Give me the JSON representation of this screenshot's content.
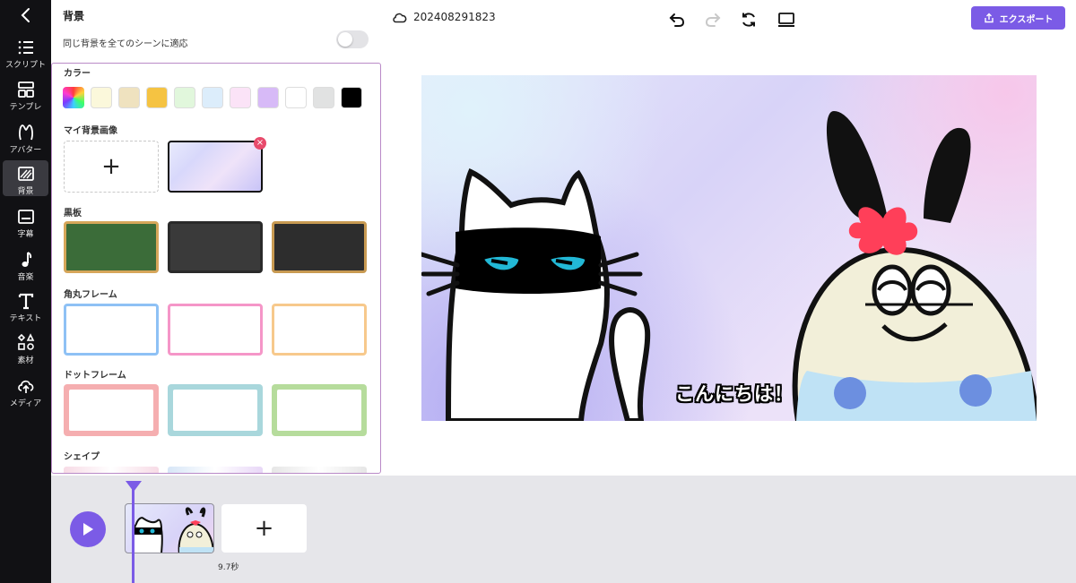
{
  "nav": {
    "items": [
      {
        "label": "スクリプト",
        "icon": "list-icon"
      },
      {
        "label": "テンプレ",
        "icon": "template-icon"
      },
      {
        "label": "アバター",
        "icon": "avatar-icon"
      },
      {
        "label": "背景",
        "icon": "background-icon"
      },
      {
        "label": "字幕",
        "icon": "subtitle-icon"
      },
      {
        "label": "音楽",
        "icon": "music-icon"
      },
      {
        "label": "テキスト",
        "icon": "text-icon"
      },
      {
        "label": "素材",
        "icon": "shapes-icon"
      },
      {
        "label": "メディア",
        "icon": "upload-icon"
      }
    ],
    "active": "背景"
  },
  "panel": {
    "title": "背景",
    "apply_all_label": "同じ背景を全てのシーンに適応",
    "apply_all_on": false,
    "sections": {
      "color": "カラー",
      "my_images": "マイ背景画像",
      "blackboard": "黒板",
      "rounded_frame": "角丸フレーム",
      "dot_frame": "ドットフレーム",
      "shape": "シェイプ"
    },
    "colors": [
      "#fbf8db",
      "#efe2bf",
      "#f5c342",
      "#e1f7dc",
      "#dcedfb",
      "#fbe3f7",
      "#d7baf7",
      "#ffffff",
      "#e1e2e2",
      "#000000"
    ],
    "add_symbol": "+",
    "delete_symbol": "×"
  },
  "topbar": {
    "file_name": "202408291823",
    "export_label": "エクスポート",
    "accent": "#7b5be6"
  },
  "canvas": {
    "subtitle": "こんにちは！"
  },
  "timeline": {
    "duration": "9.7秒",
    "add_symbol": "+"
  }
}
